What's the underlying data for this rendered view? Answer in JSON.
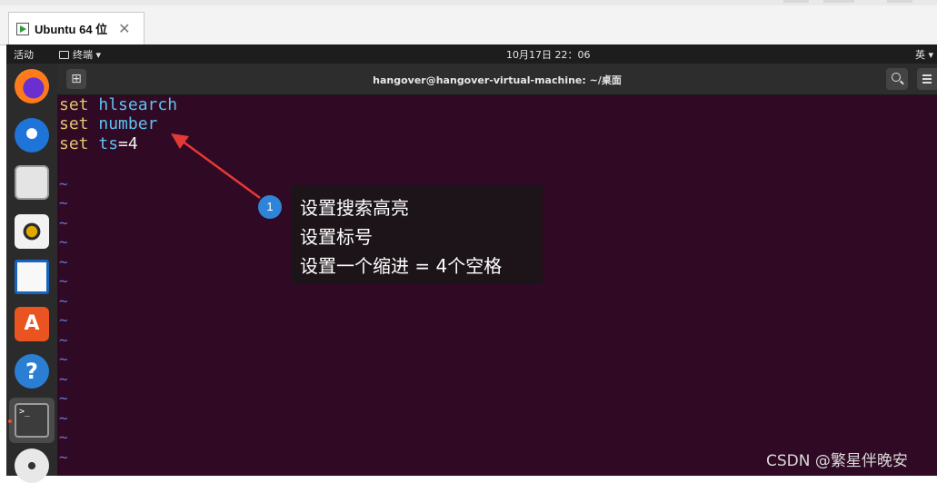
{
  "vm_tab": {
    "title": "Ubuntu 64 位",
    "close": "✕"
  },
  "gnome_bar": {
    "activities": "活动",
    "app_menu": "终端 ▾",
    "clock": "10月17日 22：06",
    "lang": "英 ▾"
  },
  "dock": {
    "items": [
      "firefox",
      "thunderbird",
      "files",
      "rhythmbox",
      "libreoffice-writer",
      "ubuntu-software",
      "help",
      "terminal",
      "dvd"
    ],
    "software_glyph": "A",
    "help_glyph": "?",
    "terminal_glyph": ">_"
  },
  "terminal": {
    "title": "hangover@hangover-virtual-machine: ~/桌面",
    "new_tab_glyph": "⊞",
    "lines": [
      {
        "kw": "set",
        "opt": "hlsearch",
        "val": ""
      },
      {
        "kw": "set",
        "opt": "number",
        "val": ""
      },
      {
        "kw": "set",
        "opt": "ts",
        "val": "=4"
      }
    ],
    "tilde": "~"
  },
  "annotation": {
    "number": "1",
    "lines": [
      "设置搜索高亮",
      "设置标号",
      "设置一个缩进 = 4个空格"
    ],
    "arrow_color": "#e53935"
  },
  "watermark": "CSDN @繁星伴晚安"
}
